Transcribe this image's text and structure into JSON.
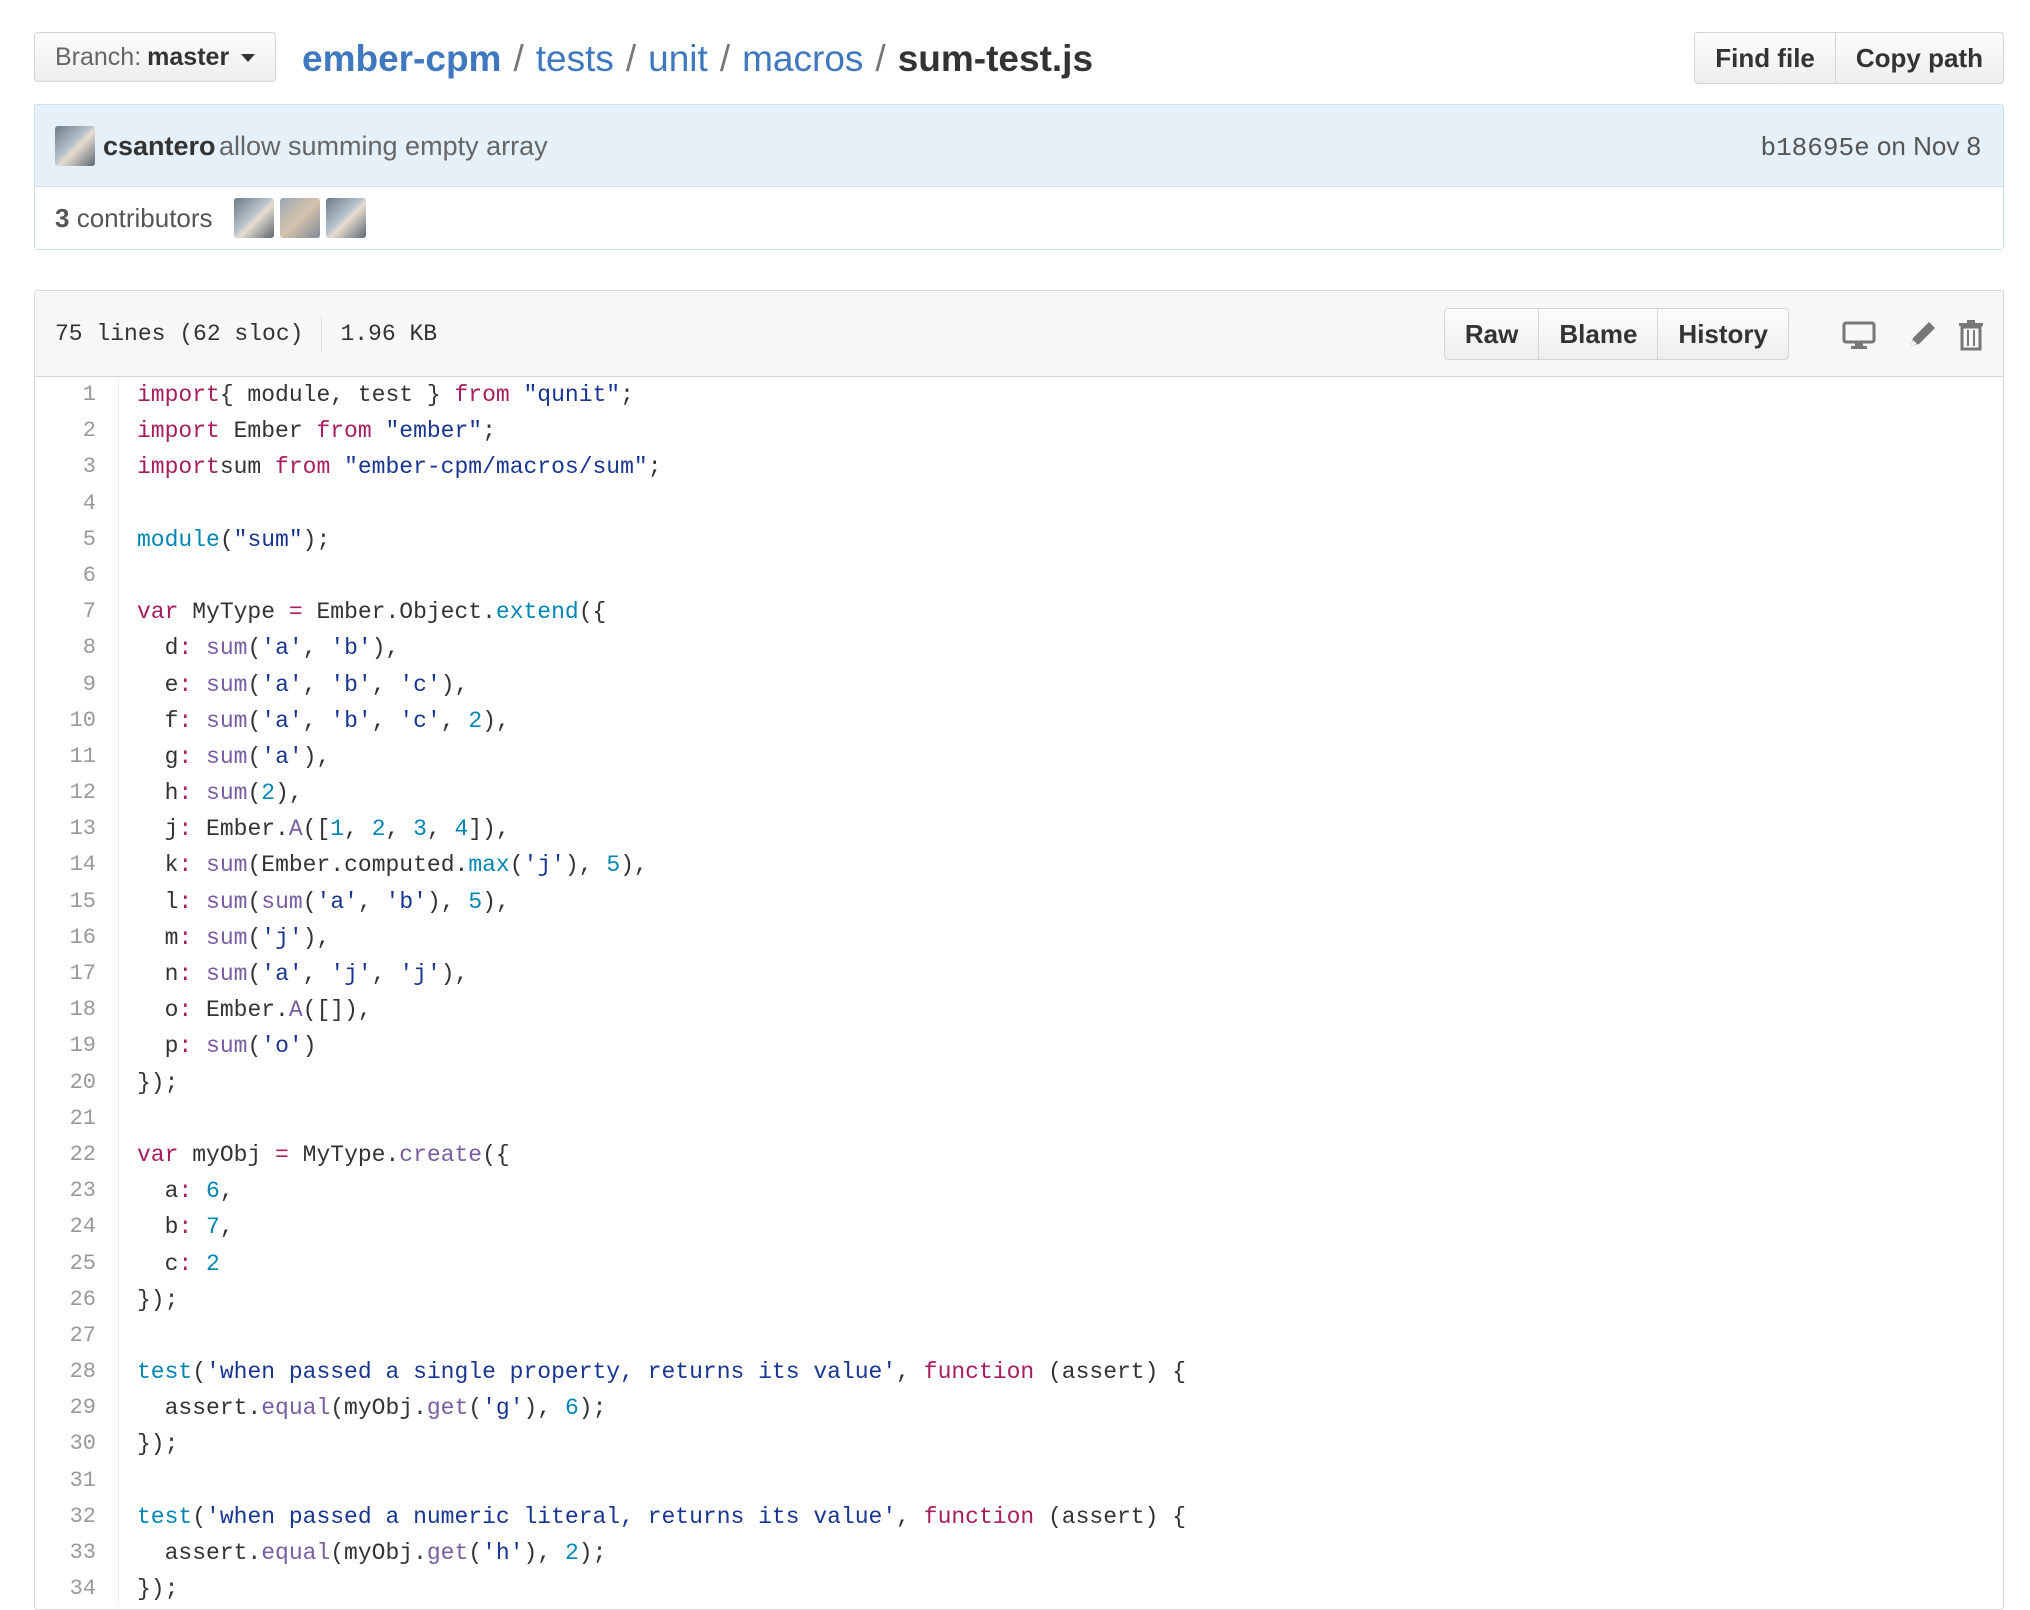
{
  "branch": {
    "label": "Branch:",
    "value": "master"
  },
  "breadcrumb": {
    "repo": "ember-cpm",
    "segments": [
      "tests",
      "unit",
      "macros"
    ],
    "file": "sum-test.js",
    "separator": "/"
  },
  "header_actions": {
    "find_file": "Find file",
    "copy_path": "Copy path"
  },
  "commit": {
    "author": "csantero",
    "message": "allow summing empty array",
    "sha": "b18695e",
    "date_prefix": "on",
    "date": "Nov 8"
  },
  "contributors": {
    "count": "3",
    "label": "contributors"
  },
  "file": {
    "lines": "75 lines (62 sloc)",
    "size": "1.96 KB"
  },
  "file_actions": {
    "raw": "Raw",
    "blame": "Blame",
    "history": "History"
  },
  "tool_icons": [
    "desktop-icon",
    "pencil-icon",
    "trash-icon"
  ],
  "colors": {
    "link": "#4078c0",
    "keyword": "#a71d5d",
    "string": "#183691",
    "function": "#795da3",
    "number": "#0086b3",
    "commit_bg": "#e5f0f8"
  },
  "code_lines": [
    [
      [
        "kw",
        "import"
      ],
      [
        "",
        "{ module, test } "
      ],
      [
        "kw",
        "from"
      ],
      [
        "",
        ""
      ],
      [
        "str",
        " \"qunit\""
      ],
      [
        "",
        ";"
      ]
    ],
    [
      [
        "kw",
        "import"
      ],
      [
        "",
        " Ember "
      ],
      [
        "kw",
        "from"
      ],
      [
        "str",
        " \"ember\""
      ],
      [
        "",
        ";"
      ]
    ],
    [
      [
        "kw",
        "import"
      ],
      [
        "",
        ""
      ],
      [
        "",
        "sum "
      ],
      [
        "kw",
        "from"
      ],
      [
        "str",
        " \"ember-cpm/macros/sum\""
      ],
      [
        "",
        ";"
      ]
    ],
    [],
    [
      [
        "en",
        "module"
      ],
      [
        "",
        "("
      ],
      [
        "str",
        "\"sum\""
      ],
      [
        "",
        ");"
      ]
    ],
    [],
    [
      [
        "kw",
        "var"
      ],
      [
        "",
        " MyType "
      ],
      [
        "kw",
        "="
      ],
      [
        "",
        " Ember.Object."
      ],
      [
        "en",
        "extend"
      ],
      [
        "",
        "({"
      ]
    ],
    [
      [
        "",
        "  d"
      ],
      [
        "kw",
        ":"
      ],
      [
        "",
        " "
      ],
      [
        "fn",
        "sum"
      ],
      [
        "",
        "("
      ],
      [
        "str",
        "'a'"
      ],
      [
        "",
        ", "
      ],
      [
        "str",
        "'b'"
      ],
      [
        "",
        "),"
      ]
    ],
    [
      [
        "",
        "  e"
      ],
      [
        "kw",
        ":"
      ],
      [
        "",
        " "
      ],
      [
        "fn",
        "sum"
      ],
      [
        "",
        "("
      ],
      [
        "str",
        "'a'"
      ],
      [
        "",
        ", "
      ],
      [
        "str",
        "'b'"
      ],
      [
        "",
        ", "
      ],
      [
        "str",
        "'c'"
      ],
      [
        "",
        "),"
      ]
    ],
    [
      [
        "",
        "  f"
      ],
      [
        "kw",
        ":"
      ],
      [
        "",
        " "
      ],
      [
        "fn",
        "sum"
      ],
      [
        "",
        "("
      ],
      [
        "str",
        "'a'"
      ],
      [
        "",
        ", "
      ],
      [
        "str",
        "'b'"
      ],
      [
        "",
        ", "
      ],
      [
        "str",
        "'c'"
      ],
      [
        "",
        ", "
      ],
      [
        "num",
        "2"
      ],
      [
        "",
        "),"
      ]
    ],
    [
      [
        "",
        "  g"
      ],
      [
        "kw",
        ":"
      ],
      [
        "",
        " "
      ],
      [
        "fn",
        "sum"
      ],
      [
        "",
        "("
      ],
      [
        "str",
        "'a'"
      ],
      [
        "",
        "),"
      ]
    ],
    [
      [
        "",
        "  h"
      ],
      [
        "kw",
        ":"
      ],
      [
        "",
        " "
      ],
      [
        "fn",
        "sum"
      ],
      [
        "",
        "("
      ],
      [
        "num",
        "2"
      ],
      [
        "",
        "),"
      ]
    ],
    [
      [
        "",
        "  j"
      ],
      [
        "kw",
        ":"
      ],
      [
        "",
        " Ember."
      ],
      [
        "fn",
        "A"
      ],
      [
        "",
        "(["
      ],
      [
        "num",
        "1"
      ],
      [
        "",
        ", "
      ],
      [
        "num",
        "2"
      ],
      [
        "",
        ", "
      ],
      [
        "num",
        "3"
      ],
      [
        "",
        ", "
      ],
      [
        "num",
        "4"
      ],
      [
        "",
        "]),"
      ]
    ],
    [
      [
        "",
        "  k"
      ],
      [
        "kw",
        ":"
      ],
      [
        "",
        " "
      ],
      [
        "fn",
        "sum"
      ],
      [
        "",
        "(Ember.computed."
      ],
      [
        "en",
        "max"
      ],
      [
        "",
        "("
      ],
      [
        "str",
        "'j'"
      ],
      [
        "",
        "), "
      ],
      [
        "num",
        "5"
      ],
      [
        "",
        "),"
      ]
    ],
    [
      [
        "",
        "  l"
      ],
      [
        "kw",
        ":"
      ],
      [
        "",
        " "
      ],
      [
        "fn",
        "sum"
      ],
      [
        "",
        "("
      ],
      [
        "fn",
        "sum"
      ],
      [
        "",
        "("
      ],
      [
        "str",
        "'a'"
      ],
      [
        "",
        ", "
      ],
      [
        "str",
        "'b'"
      ],
      [
        "",
        "), "
      ],
      [
        "num",
        "5"
      ],
      [
        "",
        "),"
      ]
    ],
    [
      [
        "",
        "  m"
      ],
      [
        "kw",
        ":"
      ],
      [
        "",
        " "
      ],
      [
        "fn",
        "sum"
      ],
      [
        "",
        "("
      ],
      [
        "str",
        "'j'"
      ],
      [
        "",
        "),"
      ]
    ],
    [
      [
        "",
        "  n"
      ],
      [
        "kw",
        ":"
      ],
      [
        "",
        " "
      ],
      [
        "fn",
        "sum"
      ],
      [
        "",
        "("
      ],
      [
        "str",
        "'a'"
      ],
      [
        "",
        ", "
      ],
      [
        "str",
        "'j'"
      ],
      [
        "",
        ", "
      ],
      [
        "str",
        "'j'"
      ],
      [
        "",
        "),"
      ]
    ],
    [
      [
        "",
        "  o"
      ],
      [
        "kw",
        ":"
      ],
      [
        "",
        " Ember."
      ],
      [
        "fn",
        "A"
      ],
      [
        "",
        "([]),"
      ]
    ],
    [
      [
        "",
        "  p"
      ],
      [
        "kw",
        ":"
      ],
      [
        "",
        " "
      ],
      [
        "fn",
        "sum"
      ],
      [
        "",
        "("
      ],
      [
        "str",
        "'o'"
      ],
      [
        "",
        ")"
      ]
    ],
    [
      [
        "",
        "});"
      ]
    ],
    [],
    [
      [
        "kw",
        "var"
      ],
      [
        "",
        " myObj "
      ],
      [
        "kw",
        "="
      ],
      [
        "",
        " MyType."
      ],
      [
        "fn",
        "create"
      ],
      [
        "",
        "({"
      ]
    ],
    [
      [
        "",
        "  a"
      ],
      [
        "kw",
        ":"
      ],
      [
        "",
        " "
      ],
      [
        "num",
        "6"
      ],
      [
        "",
        ","
      ]
    ],
    [
      [
        "",
        "  b"
      ],
      [
        "kw",
        ":"
      ],
      [
        "",
        " "
      ],
      [
        "num",
        "7"
      ],
      [
        "",
        ","
      ]
    ],
    [
      [
        "",
        "  c"
      ],
      [
        "kw",
        ":"
      ],
      [
        "",
        " "
      ],
      [
        "num",
        "2"
      ]
    ],
    [
      [
        "",
        "});"
      ]
    ],
    [],
    [
      [
        "en",
        "test"
      ],
      [
        "",
        "("
      ],
      [
        "str",
        "'when passed a single property, returns its value'"
      ],
      [
        "",
        ", "
      ],
      [
        "kw",
        "function"
      ],
      [
        "",
        " (assert) {"
      ]
    ],
    [
      [
        "",
        "  assert."
      ],
      [
        "fn",
        "equal"
      ],
      [
        "",
        "(myObj."
      ],
      [
        "fn",
        "get"
      ],
      [
        "",
        "("
      ],
      [
        "str",
        "'g'"
      ],
      [
        "",
        "), "
      ],
      [
        "num",
        "6"
      ],
      [
        "",
        ");"
      ]
    ],
    [
      [
        "",
        "});"
      ]
    ],
    [],
    [
      [
        "en",
        "test"
      ],
      [
        "",
        "("
      ],
      [
        "str",
        "'when passed a numeric literal, returns its value'"
      ],
      [
        "",
        ", "
      ],
      [
        "kw",
        "function"
      ],
      [
        "",
        " (assert) {"
      ]
    ],
    [
      [
        "",
        "  assert."
      ],
      [
        "fn",
        "equal"
      ],
      [
        "",
        "(myObj."
      ],
      [
        "fn",
        "get"
      ],
      [
        "",
        "("
      ],
      [
        "str",
        "'h'"
      ],
      [
        "",
        "), "
      ],
      [
        "num",
        "2"
      ],
      [
        "",
        ");"
      ]
    ],
    [
      [
        "",
        "});"
      ]
    ]
  ]
}
